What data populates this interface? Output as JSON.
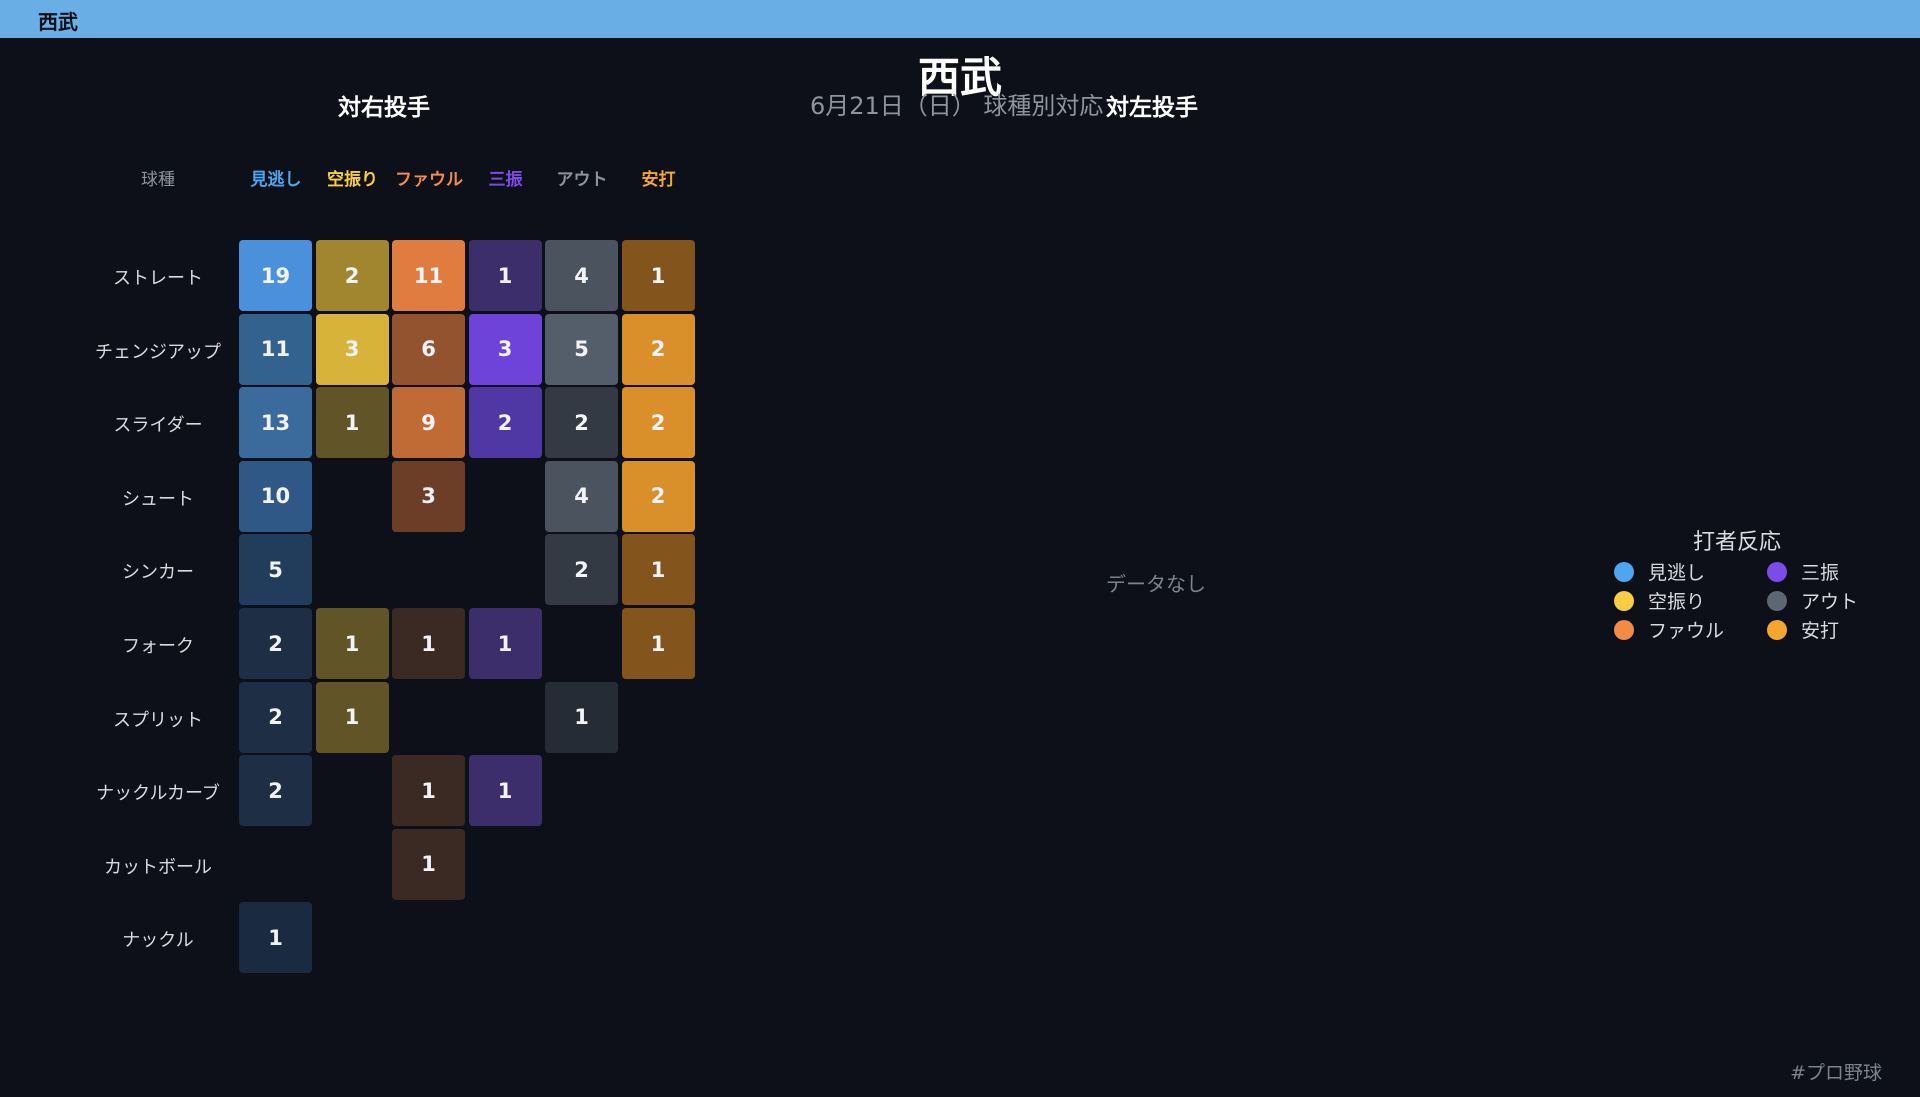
{
  "topbar": {
    "title": "西武"
  },
  "header": {
    "title": "西武",
    "subtitle": "6月21日（日） 球種別対応"
  },
  "panels": {
    "right_title": "対右投手",
    "left_title": "対左投手",
    "left_empty_text": "データなし",
    "pitch_header": "球種"
  },
  "legend": {
    "title": "打者反応",
    "items": [
      {
        "label": "見逃し",
        "color": "#4ea5f0"
      },
      {
        "label": "三振",
        "color": "#7b4ce8"
      },
      {
        "label": "空振り",
        "color": "#f6cd43"
      },
      {
        "label": "アウト",
        "color": "#5d6673"
      },
      {
        "label": "ファウル",
        "color": "#f38b48"
      },
      {
        "label": "安打",
        "color": "#f5a631"
      }
    ]
  },
  "footer": {
    "hashtag": "#プロ野球"
  },
  "chart_data": {
    "type": "heatmap",
    "title": "対右投手",
    "columns": [
      {
        "label": "見逃し",
        "color": "#4ea5f0"
      },
      {
        "label": "空振り",
        "color": "#f6cd43"
      },
      {
        "label": "ファウル",
        "color": "#f38b48"
      },
      {
        "label": "三振",
        "color": "#7b4ce8"
      },
      {
        "label": "アウト",
        "color": "#8e939c"
      },
      {
        "label": "安打",
        "color": "#f5a631"
      }
    ],
    "rows": [
      "ストレート",
      "チェンジアップ",
      "スライダー",
      "シュート",
      "シンカー",
      "フォーク",
      "スプリット",
      "ナックルカーブ",
      "カットボール",
      "ナックル"
    ],
    "values": [
      [
        19,
        2,
        11,
        1,
        4,
        1
      ],
      [
        11,
        3,
        6,
        3,
        5,
        2
      ],
      [
        13,
        1,
        9,
        2,
        2,
        2
      ],
      [
        10,
        null,
        3,
        null,
        4,
        2
      ],
      [
        5,
        null,
        null,
        null,
        2,
        1
      ],
      [
        2,
        1,
        1,
        1,
        null,
        1
      ],
      [
        2,
        1,
        null,
        null,
        1,
        null
      ],
      [
        2,
        null,
        1,
        1,
        null,
        null
      ],
      [
        null,
        null,
        1,
        null,
        null,
        null
      ],
      [
        1,
        null,
        null,
        null,
        null,
        null
      ]
    ],
    "cell_colors": [
      [
        "#4a90da",
        "#a2862f",
        "#e07c3f",
        "#3b2e6b",
        "#4a535e",
        "#83551d"
      ],
      [
        "#34628f",
        "#d7b33a",
        "#93532e",
        "#6e43d9",
        "#545e6a",
        "#d9902a"
      ],
      [
        "#3b6a9c",
        "#615527",
        "#c06a36",
        "#4f37a4",
        "#333a44",
        "#d9902a"
      ],
      [
        "#2f5886",
        null,
        "#6d3e27",
        null,
        "#4a535e",
        "#d9902a"
      ],
      [
        "#223c5b",
        null,
        null,
        null,
        "#333a44",
        "#83551d"
      ],
      [
        "#1d2e45",
        "#615527",
        "#3b2a23",
        "#3b2e6b",
        null,
        "#83551d"
      ],
      [
        "#1d2e45",
        "#615527",
        null,
        null,
        "#262c35",
        null
      ],
      [
        "#1d2e45",
        null,
        "#3b2a23",
        "#3b2e6b",
        null,
        null
      ],
      [
        null,
        null,
        "#3b2a23",
        null,
        null,
        null
      ],
      [
        "#1a2a40",
        null,
        null,
        null,
        null,
        null
      ]
    ],
    "left_panel": {
      "title": "対左投手",
      "values": []
    }
  }
}
